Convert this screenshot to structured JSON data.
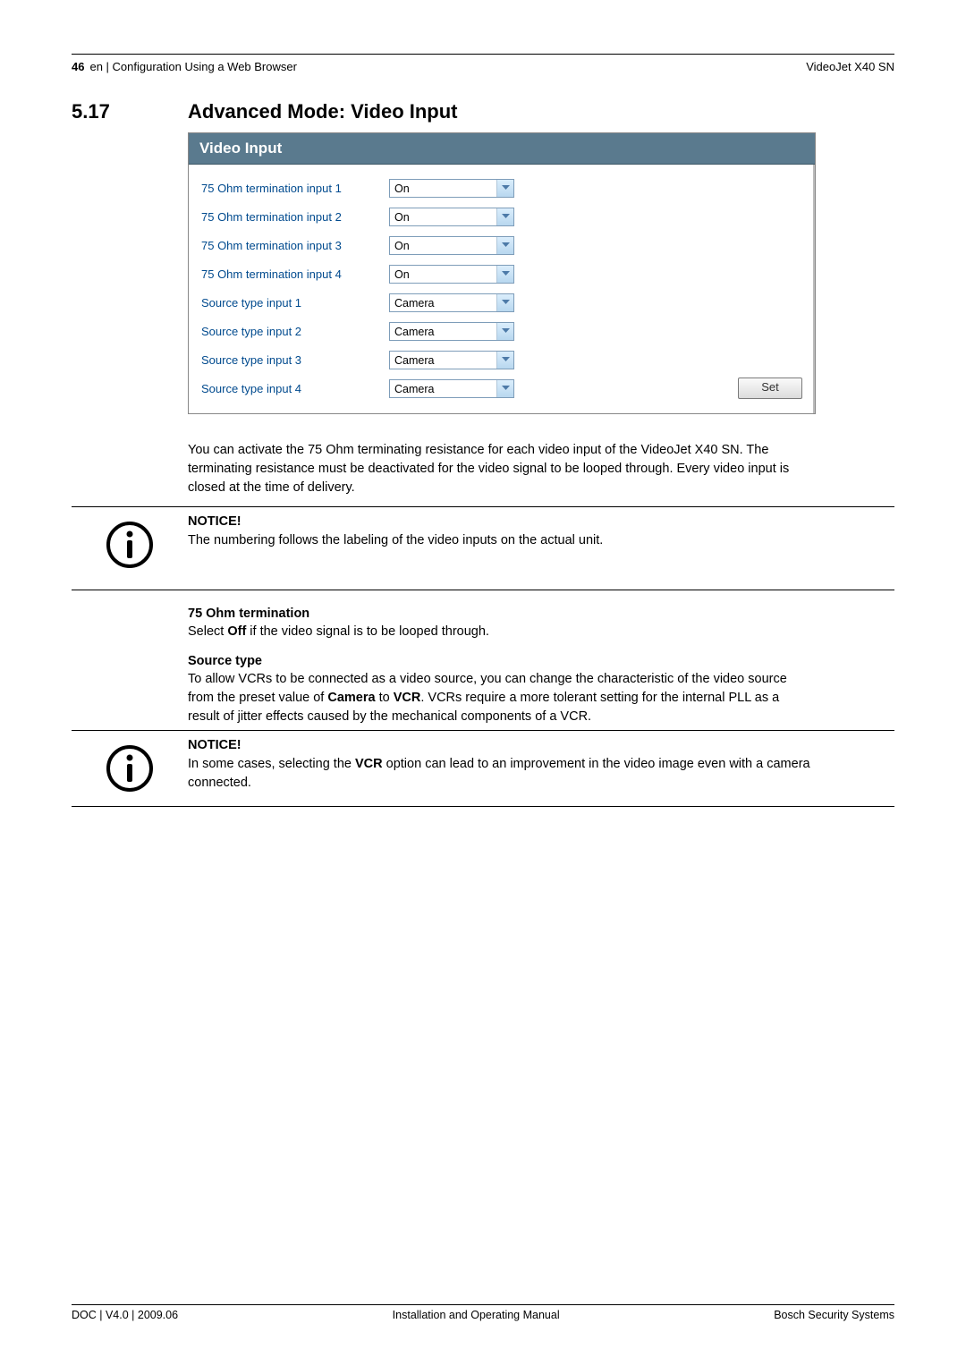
{
  "header": {
    "page_number": "46",
    "breadcrumb": "en | Configuration Using a Web Browser",
    "product": "VideoJet X40 SN"
  },
  "section": {
    "number": "5.17",
    "title": "Advanced Mode: Video Input"
  },
  "panel": {
    "title": "Video Input",
    "rows": [
      {
        "label": "75 Ohm termination input 1",
        "value": "On"
      },
      {
        "label": "75 Ohm termination input 2",
        "value": "On"
      },
      {
        "label": "75 Ohm termination input 3",
        "value": "On"
      },
      {
        "label": "75 Ohm termination input 4",
        "value": "On"
      },
      {
        "label": "Source type input 1",
        "value": "Camera"
      },
      {
        "label": "Source type input 2",
        "value": "Camera"
      },
      {
        "label": "Source type input 3",
        "value": "Camera"
      },
      {
        "label": "Source type input 4",
        "value": "Camera"
      }
    ],
    "set_label": "Set"
  },
  "para1": "You can activate the 75 Ohm terminating resistance for each video input of the VideoJet X40 SN. The terminating resistance must be deactivated for the video signal to be looped through. Every video input is closed at the time of delivery.",
  "notice1": {
    "title": "NOTICE!",
    "text": "The numbering follows the labeling of the video inputs on the actual unit."
  },
  "sub1": {
    "heading": "75 Ohm termination",
    "prefix": "Select ",
    "bold": "Off",
    "suffix": " if the video signal is to be looped through."
  },
  "sub2": {
    "heading": "Source type",
    "prefix": "To allow VCRs to be connected as a video source, you can change the characteristic of the video source from the preset value of ",
    "bold1": "Camera",
    "mid": " to ",
    "bold2": "VCR",
    "suffix": ".  VCRs require a more tolerant setting for the internal PLL as a result of jitter effects caused by the mechanical components of a VCR."
  },
  "notice2": {
    "title": "NOTICE!",
    "prefix": "In some cases, selecting the ",
    "bold": "VCR",
    "suffix": " option can lead to an improvement in the video image even with a camera connected."
  },
  "footer": {
    "left": "DOC | V4.0 | 2009.06",
    "center": "Installation and Operating Manual",
    "right": "Bosch Security Systems"
  }
}
